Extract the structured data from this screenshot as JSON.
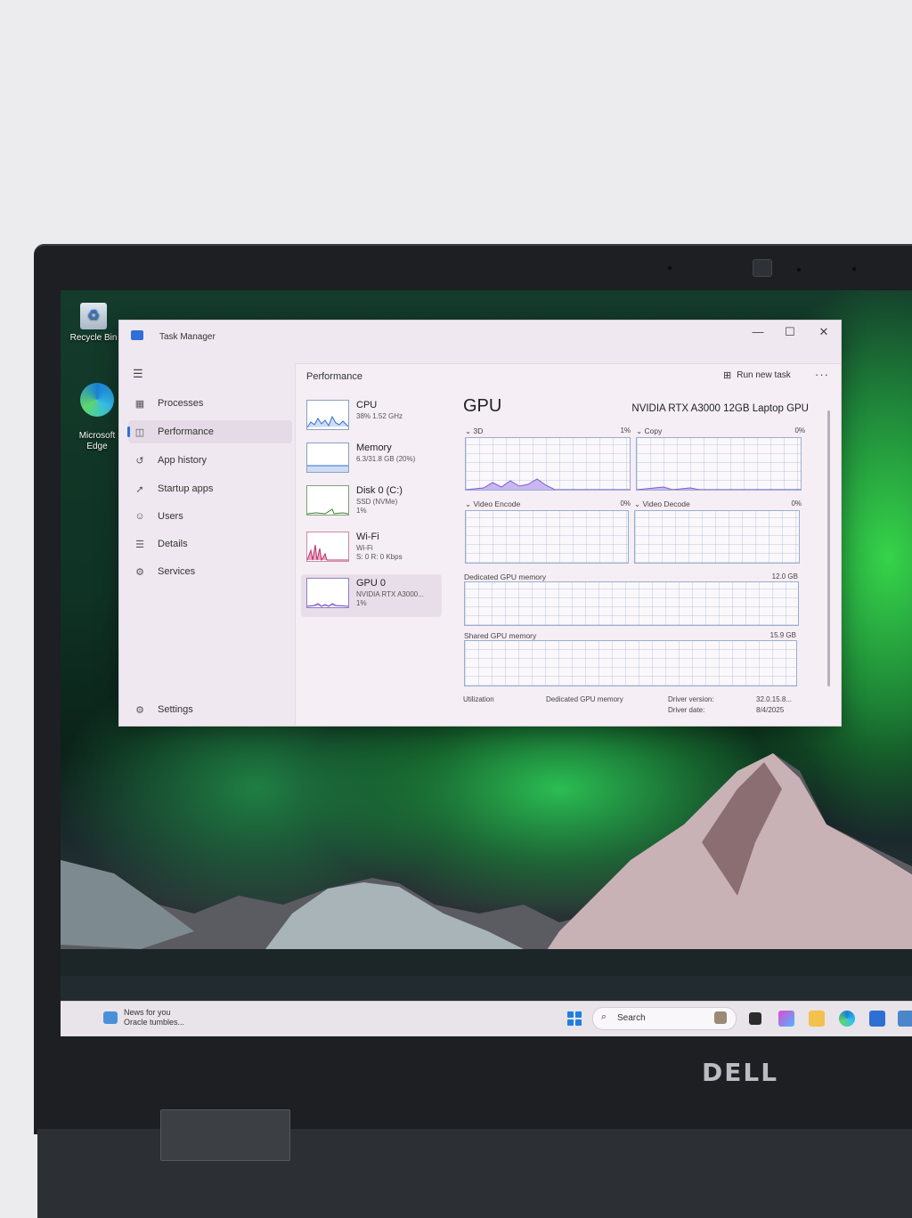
{
  "desktop": {
    "icons": [
      {
        "label": "Recycle Bin",
        "icon": "recycle-bin-icon"
      },
      {
        "label": "Microsoft\nEdge",
        "icon": "edge-icon"
      }
    ],
    "brand_logo": "DELL"
  },
  "window": {
    "title": "Task Manager",
    "controls": {
      "minimize": "—",
      "maximize": "☐",
      "close": "✕"
    }
  },
  "nav": {
    "menu_icon": "hamburger-menu-icon",
    "items": [
      {
        "label": "Processes",
        "icon": "processes-icon",
        "active": false
      },
      {
        "label": "Performance",
        "icon": "performance-icon",
        "active": true
      },
      {
        "label": "App history",
        "icon": "app-history-icon",
        "active": false
      },
      {
        "label": "Startup apps",
        "icon": "startup-apps-icon",
        "active": false
      },
      {
        "label": "Users",
        "icon": "users-icon",
        "active": false
      },
      {
        "label": "Details",
        "icon": "details-icon",
        "active": false
      },
      {
        "label": "Services",
        "icon": "services-icon",
        "active": false
      }
    ],
    "settings_label": "Settings"
  },
  "header": {
    "title": "Performance",
    "run_new_task": "Run new task",
    "more": "···"
  },
  "tiles": [
    {
      "name": "CPU",
      "sub1": "38% 1.52 GHz",
      "sub2": "",
      "sub3": "",
      "color": "#2f6fd6"
    },
    {
      "name": "Memory",
      "sub1": "6.3/31.8 GB (20%)",
      "sub2": "",
      "sub3": "",
      "color": "#2f6fd6"
    },
    {
      "name": "Disk 0 (C:)",
      "sub1": "SSD (NVMe)",
      "sub2": "1%",
      "sub3": "",
      "color": "#3a7d2e"
    },
    {
      "name": "Wi-Fi",
      "sub1": "Wi-Fi",
      "sub2": "S: 0 R: 0 Kbps",
      "sub3": "",
      "color": "#c0306a"
    },
    {
      "name": "GPU 0",
      "sub1": "NVIDIA RTX A3000...",
      "sub2": "1%",
      "sub3": "",
      "color": "#6a3fc8",
      "selected": true
    }
  ],
  "gpu": {
    "title": "GPU",
    "model": "NVIDIA RTX A3000 12GB Laptop GPU",
    "engines": [
      {
        "label": "3D",
        "value": "1%"
      },
      {
        "label": "Copy",
        "value": "0%"
      },
      {
        "label": "Video Encode",
        "value": "0%"
      },
      {
        "label": "Video Decode",
        "value": "0%"
      }
    ],
    "dedicated": {
      "label": "Dedicated GPU memory",
      "value": "12.0 GB"
    },
    "shared": {
      "label": "Shared GPU memory",
      "value": "15.9 GB"
    },
    "stats": {
      "utilization_label": "Utilization",
      "dedicated_label": "Dedicated GPU memory",
      "driver_version_label": "Driver version:",
      "driver_version_value": "32.0.15.8...",
      "driver_date_label": "Driver date:",
      "driver_date_value": "8/4/2025"
    }
  },
  "taskbar": {
    "news_title": "News for you",
    "news_sub": "Oracle tumbles...",
    "search_placeholder": "Search"
  }
}
